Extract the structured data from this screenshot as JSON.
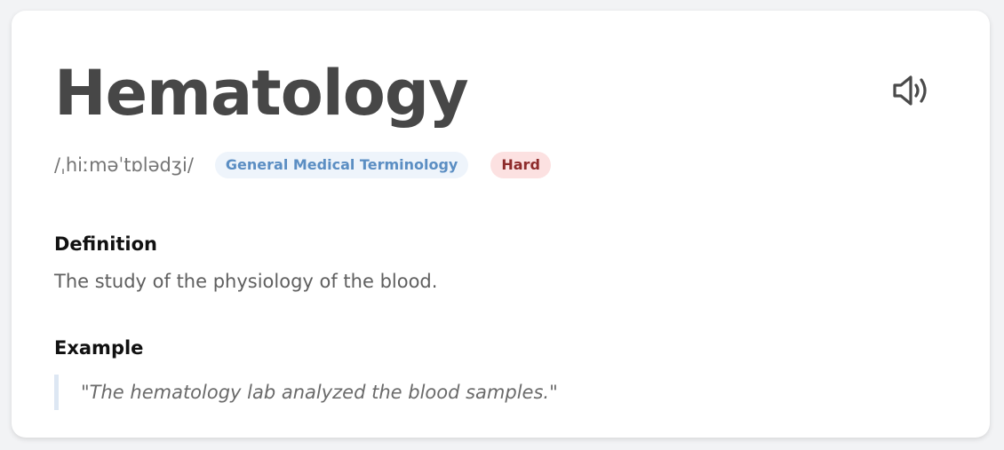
{
  "term": {
    "word": "Hematology",
    "phonetic": "/ˌhiːməˈtɒlədʒi/",
    "category": "General Medical Terminology",
    "difficulty": "Hard"
  },
  "audio": {
    "icon": "speaker-icon"
  },
  "definition": {
    "label": "Definition",
    "text": "The study of the physiology of the blood."
  },
  "example": {
    "label": "Example",
    "text": "\"The hematology lab analyzed the blood samples.\""
  },
  "colors": {
    "category_badge_bg": "#eef4fb",
    "category_badge_text": "#5b8ec3",
    "difficulty_badge_bg": "#fce1e1",
    "difficulty_badge_text": "#8e2b2b",
    "quote_border": "#dde7f3"
  }
}
